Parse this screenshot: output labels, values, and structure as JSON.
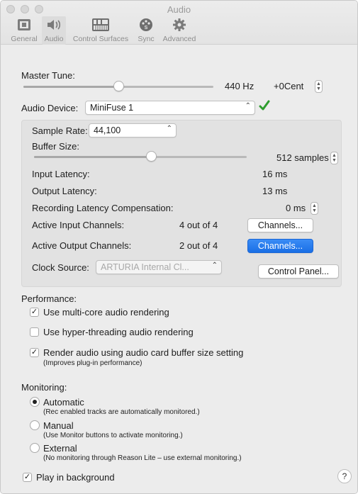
{
  "window": {
    "title": "Audio"
  },
  "toolbar": {
    "items": [
      {
        "label": "General",
        "icon": "general-icon"
      },
      {
        "label": "Audio",
        "icon": "speaker-icon",
        "active": true
      },
      {
        "label": "Control Surfaces",
        "icon": "keyboard-icon"
      },
      {
        "label": "Sync",
        "icon": "sync-icon"
      },
      {
        "label": "Advanced",
        "icon": "gear-icon"
      }
    ]
  },
  "master_tune": {
    "label": "Master Tune:",
    "hz": "440 Hz",
    "cent": "+0Cent",
    "slider_level": 0.5
  },
  "audio_device": {
    "label": "Audio Device:",
    "value": "MiniFuse 1",
    "status_icon": "checkmark-icon",
    "status_color": "#2e9d2e"
  },
  "device": {
    "sample_rate_label": "Sample Rate:",
    "sample_rate_value": "44,100",
    "buffer_size_label": "Buffer Size:",
    "buffer_size_value": "512 samples",
    "buffer_slider_level": 0.55,
    "input_latency_label": "Input Latency:",
    "input_latency_value": "16 ms",
    "output_latency_label": "Output Latency:",
    "output_latency_value": "13 ms",
    "rec_comp_label": "Recording Latency Compensation:",
    "rec_comp_value": "0 ms",
    "active_input_label": "Active Input Channels:",
    "active_input_value": "4 out of 4",
    "active_output_label": "Active Output Channels:",
    "active_output_value": "2 out of 4",
    "channels_button": "Channels...",
    "clock_source_label": "Clock Source:",
    "clock_source_value": "ARTURIA Internal Cl...",
    "control_panel_button": "Control Panel..."
  },
  "performance": {
    "heading": "Performance:",
    "multicore_label": "Use multi-core audio rendering",
    "multicore_checked": true,
    "hyperthreading_label": "Use hyper-threading audio rendering",
    "hyperthreading_checked": false,
    "buffer_setting_label": "Render audio using audio card buffer size setting",
    "buffer_setting_note": "(Improves plug-in performance)",
    "buffer_setting_checked": true
  },
  "monitoring": {
    "heading": "Monitoring:",
    "options": [
      {
        "label": "Automatic",
        "note": "(Rec enabled tracks are automatically monitored.)",
        "selected": true
      },
      {
        "label": "Manual",
        "note": "(Use Monitor buttons to activate monitoring.)",
        "selected": false
      },
      {
        "label": "External",
        "note": "(No monitoring through Reason Lite – use external monitoring.)",
        "selected": false
      }
    ]
  },
  "play_in_background": {
    "label": "Play in background",
    "checked": true
  },
  "help": {
    "label": "?"
  },
  "colors": {
    "accent": "#1a6fe6",
    "window_bg": "#ececec",
    "panel_bg": "#e2e2e2"
  }
}
